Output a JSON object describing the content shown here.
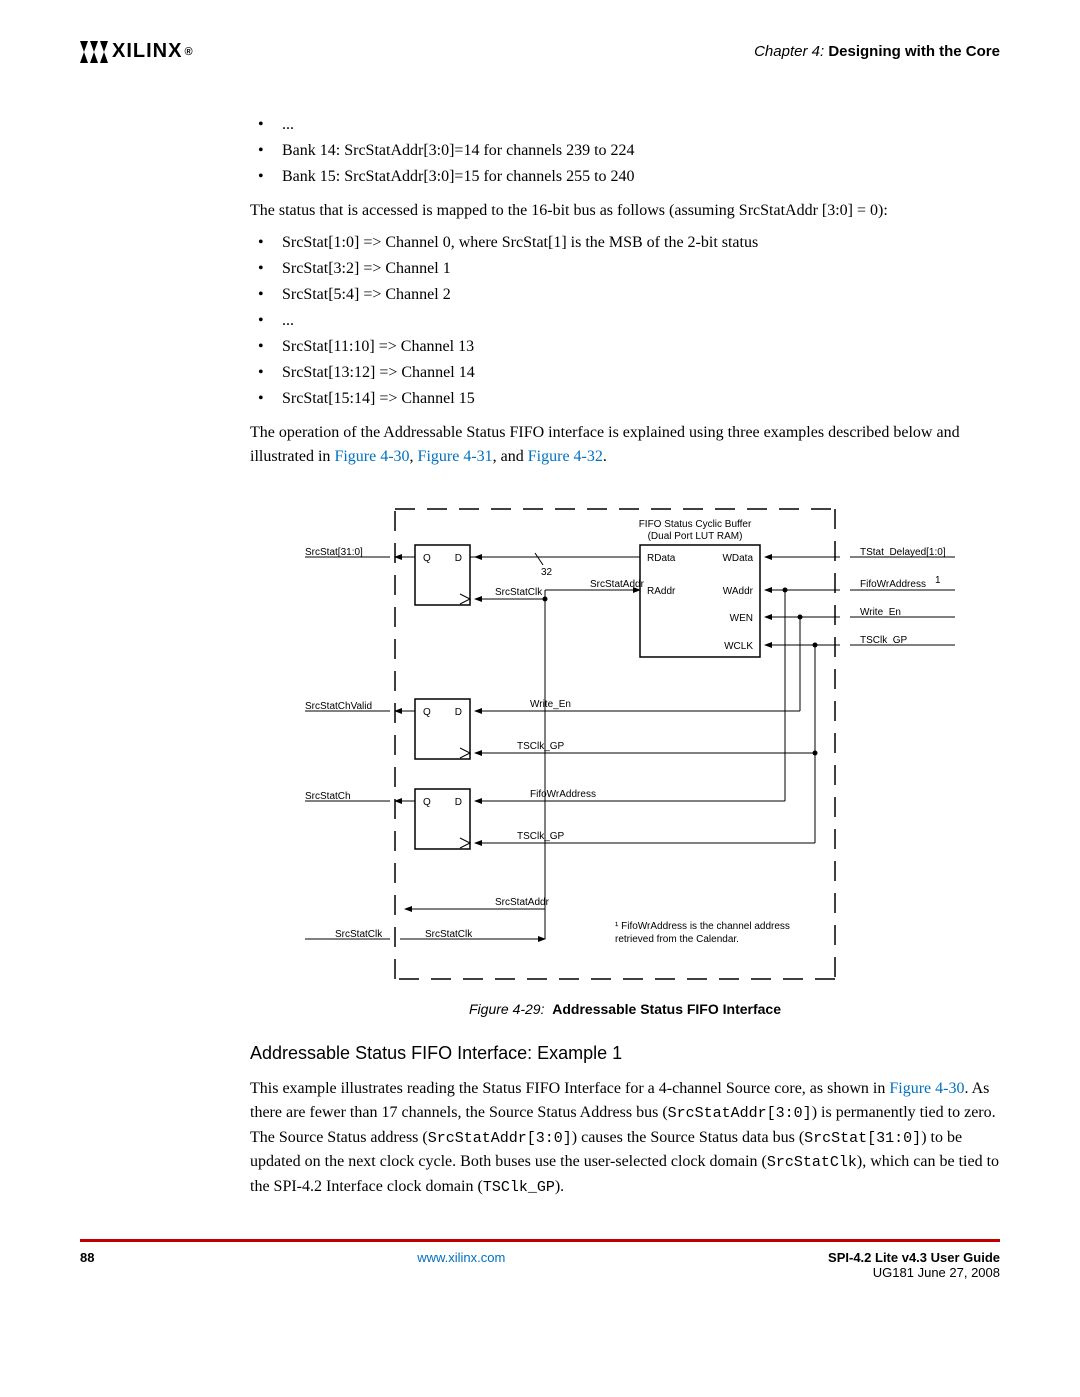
{
  "header": {
    "logo_text": "XILINX",
    "reg": "®",
    "chapter_prefix": "Chapter 4:",
    "chapter_title": "Designing with the Core"
  },
  "bullets_top": [
    "...",
    "Bank 14: SrcStatAddr[3:0]=14 for channels 239 to 224",
    "Bank 15: SrcStatAddr[3:0]=15 for channels 255 to 240"
  ],
  "para1": "The status that is accessed is mapped to the 16-bit bus as follows (assuming SrcStatAddr [3:0] = 0):",
  "bullets_status": [
    "SrcStat[1:0] => Channel 0, where SrcStat[1] is the MSB of the 2-bit status",
    "SrcStat[3:2] => Channel 1",
    "SrcStat[5:4] => Channel 2",
    "...",
    "SrcStat[11:10] => Channel 13",
    "SrcStat[13:12] => Channel 14",
    "SrcStat[15:14] => Channel 15"
  ],
  "para2_a": "The operation of the Addressable Status FIFO interface is explained using three examples described below and illustrated in ",
  "para2_link1": "Figure 4-30",
  "para2_b": ", ",
  "para2_link2": "Figure 4-31",
  "para2_c": ", and ",
  "para2_link3": "Figure 4-32",
  "para2_d": ".",
  "figure": {
    "caption_prefix": "Figure 4-29:",
    "caption_title": "Addressable Status FIFO Interface",
    "labels": {
      "srcstat310": "SrcStat[31:0]",
      "srcstatchvalid": "SrcStatChValid",
      "srcstatch": "SrcStatCh",
      "srcstatclk_left": "SrcStatClk",
      "Q": "Q",
      "D": "D",
      "thirtytwo": "32",
      "srcstatclk_mid": "SrcStatClk",
      "srcstataddr_top": "SrcStatAddr",
      "fifo_title1": "FIFO Status Cyclic Buffer",
      "fifo_title2": "(Dual Port LUT RAM)",
      "rdata": "RData",
      "raddr": "RAddr",
      "wdata": "WData",
      "waddr": "WAddr",
      "wen": "WEN",
      "wclk": "WCLK",
      "tstat_delayed": "TStat_Delayed[1:0]",
      "fifowraddress": "FifoWrAddress",
      "one": "1",
      "write_en_r": "Write_En",
      "tsclk_gp_r": "TSClk_GP",
      "write_en_m": "Write_En",
      "tsclk_gp_m1": "TSClk_GP",
      "fifowraddress_m": "FifoWrAddress",
      "tsclk_gp_m2": "TSClk_GP",
      "srcstataddr_b": "SrcStatAddr",
      "srcstatclk_b": "SrcStatClk",
      "note1": "¹ FifoWrAddress is the channel address",
      "note2": "retrieved from the Calendar."
    }
  },
  "subhead": "Addressable Status FIFO Interface: Example 1",
  "para3_a": "This example illustrates reading the Status FIFO Interface for a 4-channel Source core, as shown in ",
  "para3_link": "Figure 4-30",
  "para3_b": ". As there are fewer than 17 channels, the Source Status Address bus (",
  "para3_code1": "SrcStatAddr[3:0]",
  "para3_c": ") is permanently tied to zero. The Source Status address (",
  "para3_code2": "SrcStatAddr[3:0]",
  "para3_d": ") causes the Source Status data bus (",
  "para3_code3": "SrcStat[31:0]",
  "para3_e": ") to be updated on the next clock cycle. Both buses use the user-selected clock domain (",
  "para3_code4": "SrcStatClk",
  "para3_f": "), which can be tied to the SPI-4.2 Interface clock domain (",
  "para3_code5": "TSClk_GP",
  "para3_g": ").",
  "footer": {
    "page": "88",
    "url": "www.xilinx.com",
    "doc_title": "SPI-4.2 Lite v4.3 User Guide",
    "doc_id": "UG181 June 27, 2008"
  }
}
